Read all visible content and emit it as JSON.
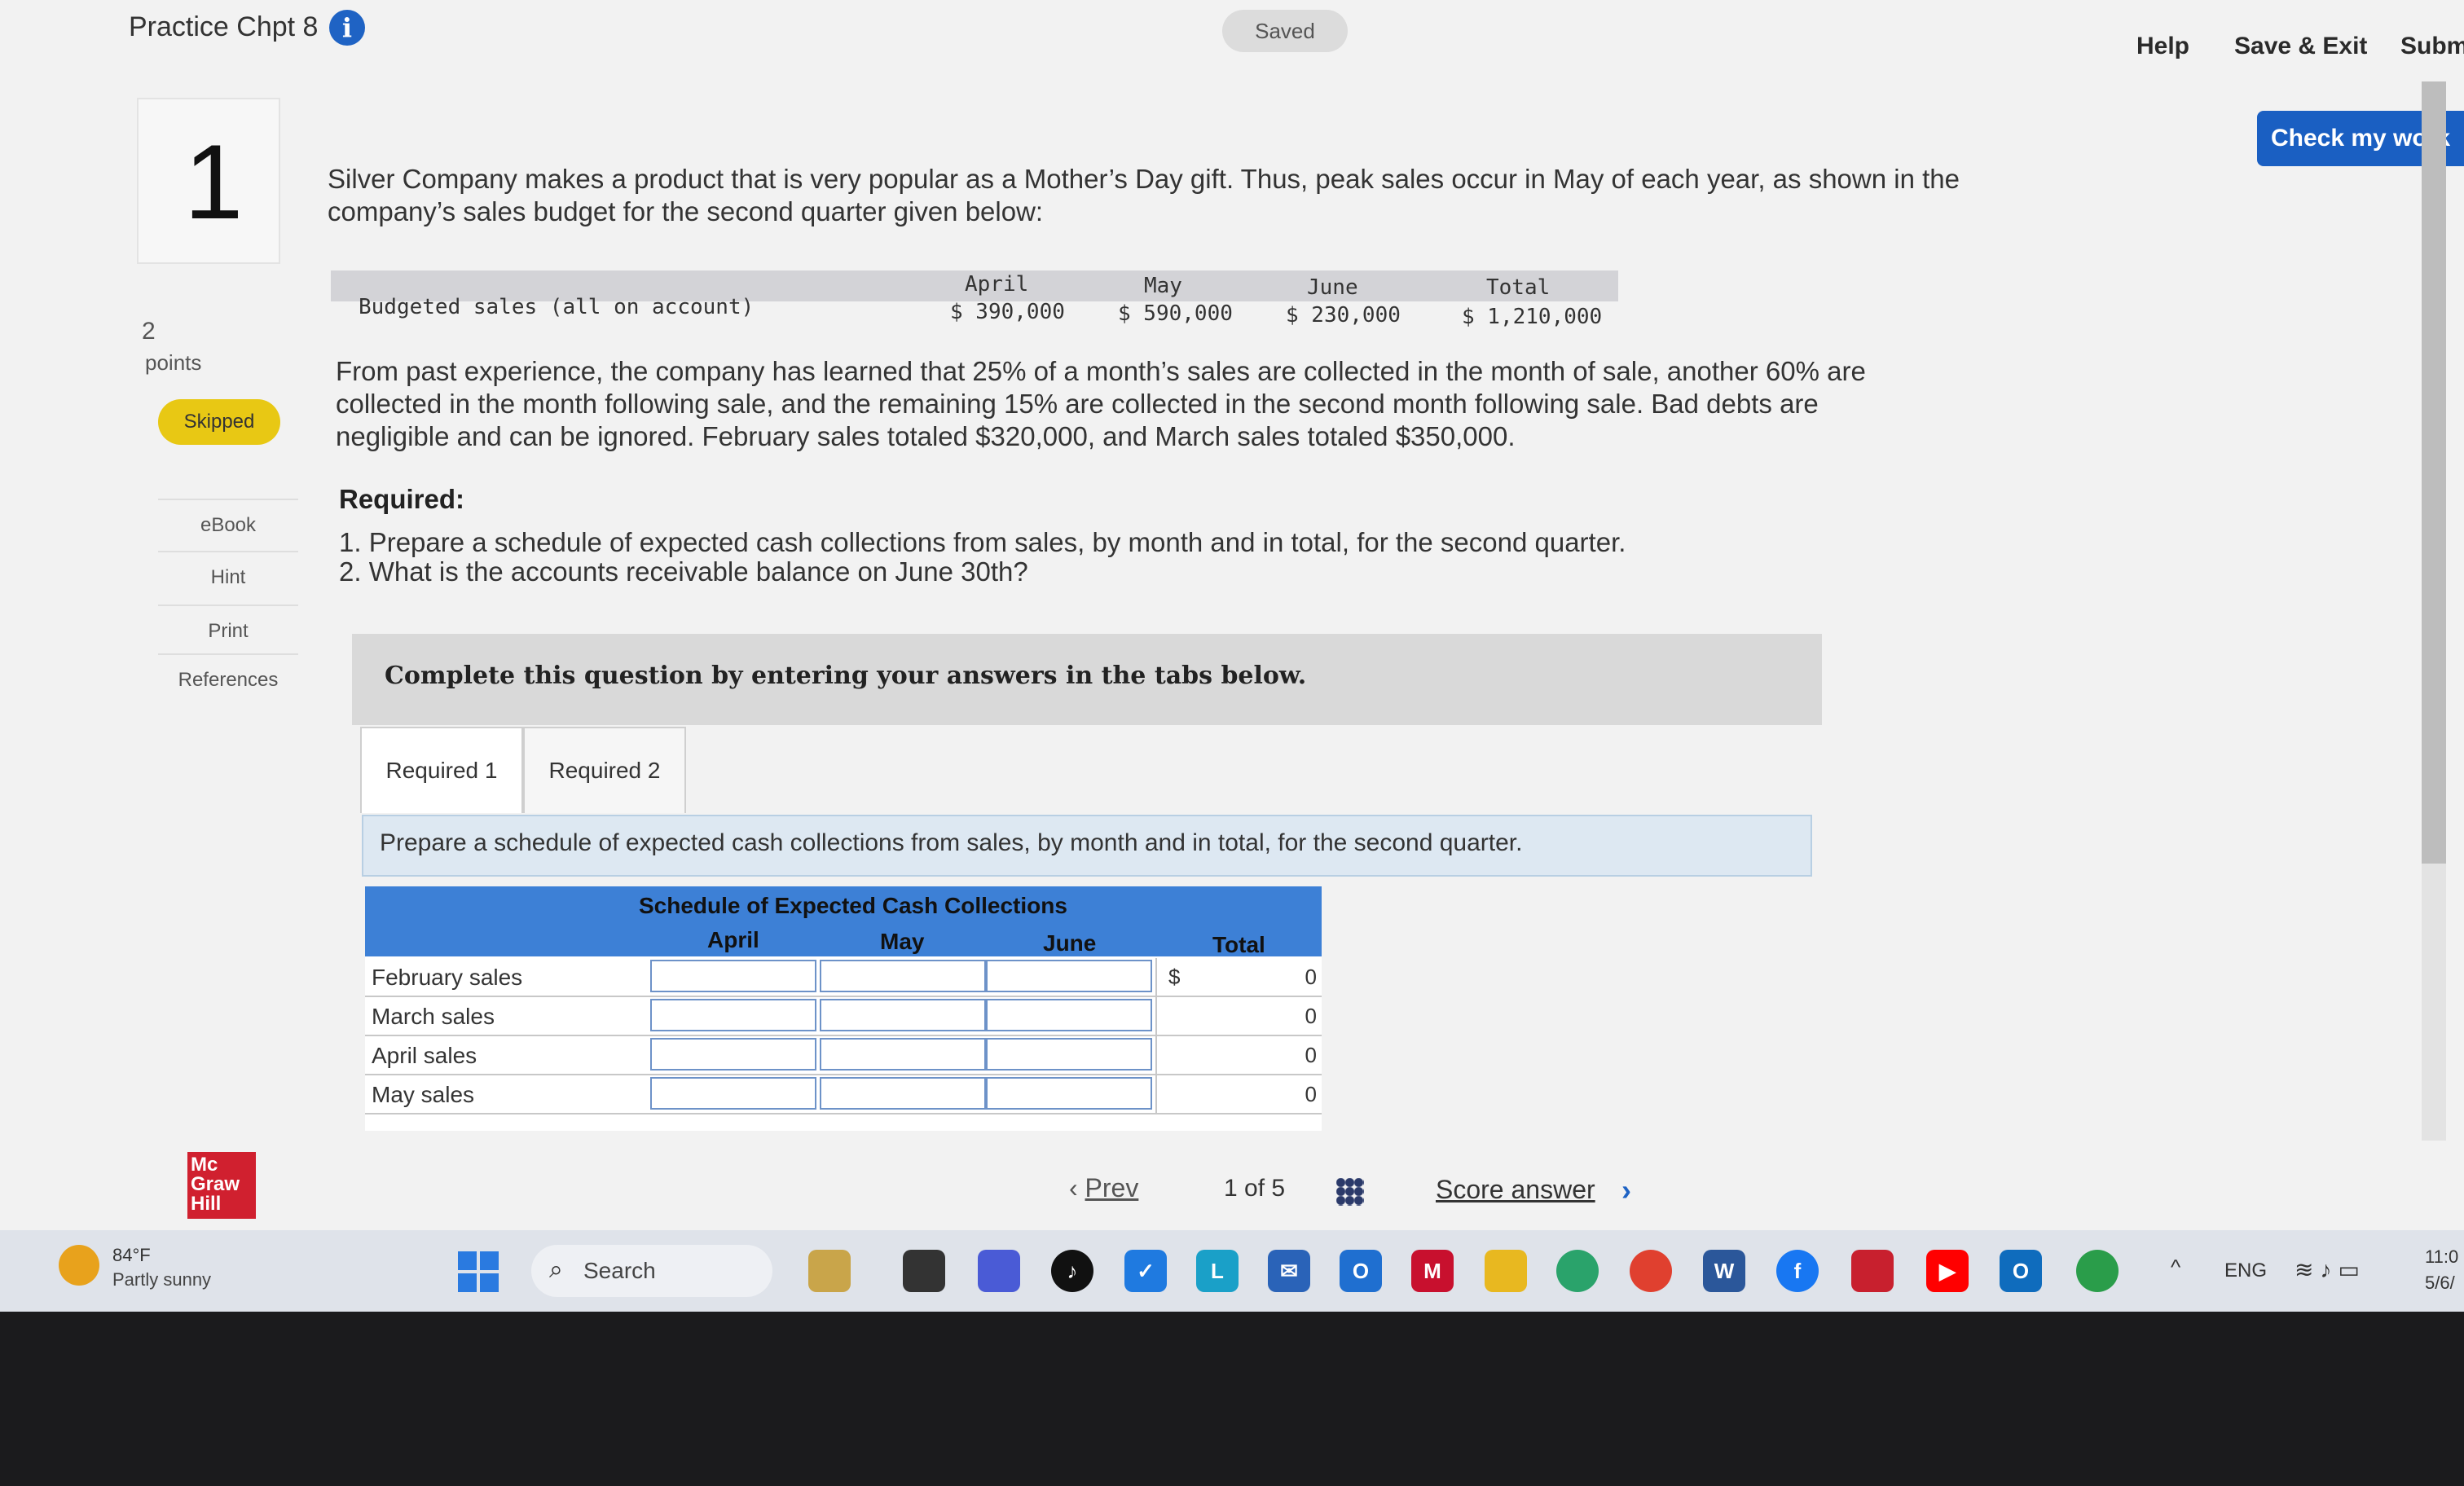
{
  "header": {
    "title": "Practice Chpt 8",
    "saved_label": "Saved",
    "help_label": "Help",
    "save_exit_label": "Save & Exit",
    "submit_label": "Subm",
    "check_work_label": "Check my work"
  },
  "question": {
    "number": "1",
    "points_value": "2",
    "points_label": "points",
    "status_badge": "Skipped",
    "tools": [
      "eBook",
      "Hint",
      "Print",
      "References"
    ],
    "intro": "Silver Company makes a product that is very popular as a Mother’s Day gift. Thus, peak sales occur in May of each year, as shown in the company’s sales budget for the second quarter given below:",
    "sales_budget": {
      "row_label": "Budgeted sales (all on account)",
      "months": [
        "April",
        "May",
        "June",
        "Total"
      ],
      "values": [
        "$ 390,000",
        "$ 590,000",
        "$ 230,000",
        "$ 1,210,000"
      ]
    },
    "experience": "From past experience, the company has learned that 25% of a month’s sales are collected in the month of sale, another 60% are collected in the month following sale, and the remaining 15% are collected in the second month following sale. Bad debts are negligible and can be ignored. February sales totaled $320,000, and March sales totaled $350,000.",
    "required_heading": "Required:",
    "required_1": "1. Prepare a schedule of expected cash collections from sales, by month and in total, for the second quarter.",
    "required_2": "2. What is the accounts receivable balance on June 30th?"
  },
  "instructions": "Complete this question by entering your answers in the tabs below.",
  "tabs": [
    {
      "label": "Required 1",
      "active": true
    },
    {
      "label": "Required 2",
      "active": false
    }
  ],
  "tab_prompt": "Prepare a schedule of expected cash collections from sales, by month and in total, for the second quarter.",
  "schedule": {
    "title": "Schedule of Expected Cash Collections",
    "columns": [
      "April",
      "May",
      "June",
      "Total"
    ],
    "rows": [
      {
        "label": "February sales",
        "april": "",
        "may": "",
        "june": "",
        "total_prefix": "$",
        "total": "0"
      },
      {
        "label": "March sales",
        "april": "",
        "may": "",
        "june": "",
        "total_prefix": "",
        "total": "0"
      },
      {
        "label": "April sales",
        "april": "",
        "may": "",
        "june": "",
        "total_prefix": "",
        "total": "0"
      },
      {
        "label": "May sales",
        "april": "",
        "may": "",
        "june": "",
        "total_prefix": "",
        "total": "0"
      }
    ]
  },
  "footer": {
    "prev_label": "Prev",
    "page_current": "1",
    "page_of": "of",
    "page_total": "5",
    "score_label": "Score answer",
    "logo_text": "Mc Graw Hill"
  },
  "taskbar": {
    "weather_temp": "84°F",
    "weather_desc": "Partly sunny",
    "search_label": "Search",
    "language": "ENG",
    "time": "11:0",
    "date": "5/6/"
  },
  "colors": {
    "accent_blue": "#1a5fc2",
    "table_header_blue": "#3d80d6",
    "skipped_yellow": "#e8c814",
    "logo_red": "#d0202f"
  }
}
